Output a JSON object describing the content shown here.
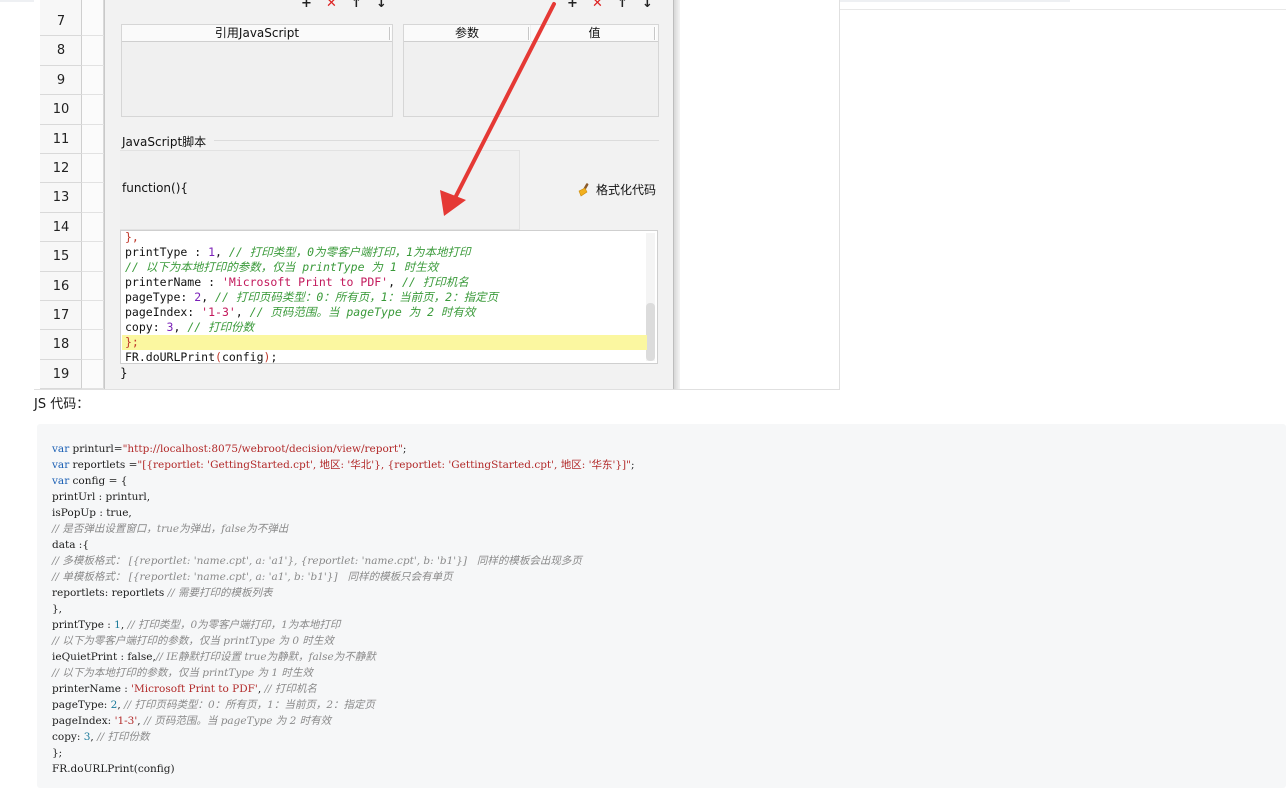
{
  "screenshot": {
    "row_numbers": [
      "7",
      "8",
      "9",
      "10",
      "11",
      "12",
      "13",
      "14",
      "15",
      "16",
      "17",
      "18",
      "19"
    ],
    "toolbar_left": [
      "+",
      "✕",
      "↑",
      "↓"
    ],
    "toolbar_right": [
      "+",
      "✕",
      "↑",
      "↓"
    ],
    "ref_js_header": "引用JavaScript",
    "param_header": "参数",
    "value_header": "值",
    "section_label": "JavaScript脚本",
    "function_label": "function(){",
    "format_button": "格式化代码",
    "closing_brace": "}",
    "editor_lines": [
      [
        {
          "t": "},",
          "c": "br"
        }
      ],
      [
        {
          "t": "printType : ",
          "c": ""
        },
        {
          "t": "1",
          "c": "num"
        },
        {
          "t": ", ",
          "c": ""
        },
        {
          "t": "// 打印类型，0为零客户端打印，1为本地打印",
          "c": "cm"
        }
      ],
      [
        {
          "t": "// 以下为本地打印的参数，仅当 printType 为 1 时生效",
          "c": "cm"
        }
      ],
      [
        {
          "t": "printerName : ",
          "c": ""
        },
        {
          "t": "'Microsoft Print to PDF'",
          "c": "str"
        },
        {
          "t": ", ",
          "c": ""
        },
        {
          "t": "// 打印机名",
          "c": "cm"
        }
      ],
      [
        {
          "t": "pageType: ",
          "c": ""
        },
        {
          "t": "2",
          "c": "num"
        },
        {
          "t": ", ",
          "c": ""
        },
        {
          "t": "// 打印页码类型：0：所有页，1：当前页，2：指定页",
          "c": "cm"
        }
      ],
      [
        {
          "t": "pageIndex: ",
          "c": ""
        },
        {
          "t": "'1-3'",
          "c": "str"
        },
        {
          "t": ", ",
          "c": ""
        },
        {
          "t": "// 页码范围。当 pageType 为 2 时有效",
          "c": "cm"
        }
      ],
      [
        {
          "t": "copy: ",
          "c": ""
        },
        {
          "t": "3",
          "c": "num"
        },
        {
          "t": ", ",
          "c": ""
        },
        {
          "t": "// 打印份数",
          "c": "cm"
        }
      ],
      [
        {
          "t": "};",
          "c": "br"
        }
      ],
      [
        {
          "t": "FR.doURLPrint",
          "c": ""
        },
        {
          "t": "(",
          "c": "br"
        },
        {
          "t": "config",
          "c": ""
        },
        {
          "t": ")",
          "c": "br"
        },
        {
          "t": ";",
          "c": ""
        }
      ]
    ]
  },
  "caption": "JS 代码：",
  "code_lines": [
    [
      {
        "t": "var",
        "c": "k"
      },
      {
        "t": " printurl=",
        "c": ""
      },
      {
        "t": "\"http://localhost:8075/webroot/decision/view/report\"",
        "c": "s"
      },
      {
        "t": ";",
        "c": ""
      }
    ],
    [
      {
        "t": "var",
        "c": "k"
      },
      {
        "t": " reportlets =",
        "c": ""
      },
      {
        "t": "\"[{reportlet: 'GettingStarted.cpt', 地区: '华北'}, {reportlet: 'GettingStarted.cpt', 地区: '华东'}]\"",
        "c": "s"
      },
      {
        "t": ";",
        "c": ""
      }
    ],
    [
      {
        "t": "var",
        "c": "k"
      },
      {
        "t": " config = {",
        "c": ""
      }
    ],
    [
      {
        "t": "printUrl : printurl,",
        "c": ""
      }
    ],
    [
      {
        "t": "isPopUp : true,",
        "c": ""
      }
    ],
    [
      {
        "t": "// 是否弹出设置窗口，true为弹出，false为不弹出",
        "c": "cm"
      }
    ],
    [
      {
        "t": "data :{",
        "c": ""
      }
    ],
    [
      {
        "t": "// 多模板格式： [{reportlet: 'name.cpt', a: 'a1'}, {reportlet: 'name.cpt', b: 'b1'}]   同样的模板会出现多页",
        "c": "cm"
      }
    ],
    [
      {
        "t": "// 单模板格式： [{reportlet: 'name.cpt', a: 'a1', b: 'b1'}]   同样的模板只会有单页",
        "c": "cm"
      }
    ],
    [
      {
        "t": "reportlets: reportlets ",
        "c": ""
      },
      {
        "t": "// 需要打印的模板列表",
        "c": "cm"
      }
    ],
    [
      {
        "t": "},",
        "c": ""
      }
    ],
    [
      {
        "t": "printType : ",
        "c": ""
      },
      {
        "t": "1",
        "c": "n"
      },
      {
        "t": ", ",
        "c": ""
      },
      {
        "t": "// 打印类型，0为零客户端打印，1为本地打印",
        "c": "cm"
      }
    ],
    [
      {
        "t": "// 以下为零客户端打印的参数，仅当 printType 为 0 时生效",
        "c": "cm"
      }
    ],
    [
      {
        "t": "ieQuietPrint : false,",
        "c": ""
      },
      {
        "t": "// IE静默打印设置 true为静默，false为不静默",
        "c": "cm"
      }
    ],
    [
      {
        "t": "// 以下为本地打印的参数，仅当 printType 为 1 时生效",
        "c": "cm"
      }
    ],
    [
      {
        "t": "printerName : ",
        "c": ""
      },
      {
        "t": "'Microsoft Print to PDF'",
        "c": "s"
      },
      {
        "t": ", ",
        "c": ""
      },
      {
        "t": "// 打印机名",
        "c": "cm"
      }
    ],
    [
      {
        "t": "pageType: ",
        "c": ""
      },
      {
        "t": "2",
        "c": "n"
      },
      {
        "t": ", ",
        "c": ""
      },
      {
        "t": "// 打印页码类型：0：所有页，1：当前页，2：指定页",
        "c": "cm"
      }
    ],
    [
      {
        "t": "pageIndex: ",
        "c": ""
      },
      {
        "t": "'1-3'",
        "c": "s"
      },
      {
        "t": ", ",
        "c": ""
      },
      {
        "t": "// 页码范围。当 pageType 为 2 时有效",
        "c": "cm"
      }
    ],
    [
      {
        "t": "copy: ",
        "c": ""
      },
      {
        "t": "3",
        "c": "n"
      },
      {
        "t": ", ",
        "c": ""
      },
      {
        "t": "// 打印份数",
        "c": "cm"
      }
    ],
    [
      {
        "t": "};",
        "c": ""
      }
    ],
    [
      {
        "t": "FR.doURLPrint(config)",
        "c": ""
      }
    ]
  ],
  "colors": {
    "arrow": "#e53935",
    "highlight_line": "#fbf7a0",
    "code_bg": "#f6f7f8"
  }
}
